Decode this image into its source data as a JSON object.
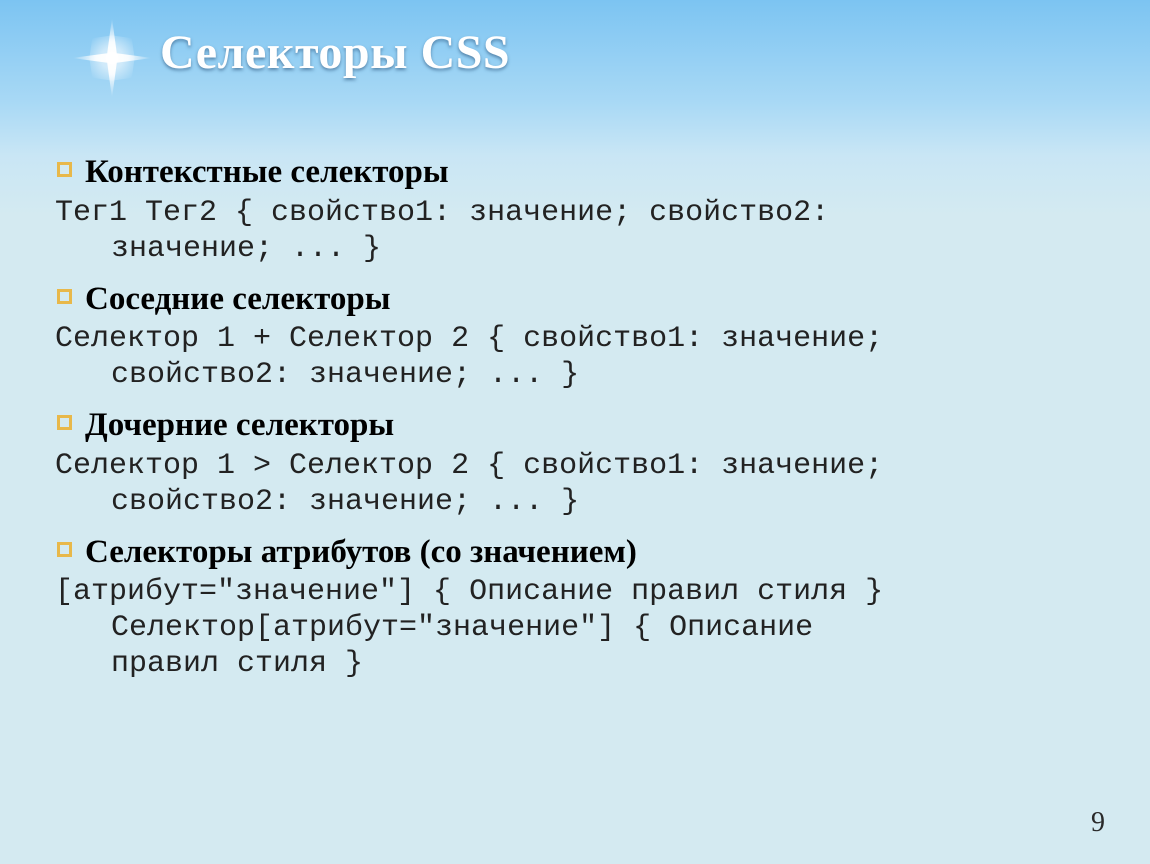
{
  "title": "Селекторы CSS",
  "sections": [
    {
      "heading": "Контекстные селекторы",
      "code_l1": "Тег1 Тег2 { свойство1: значение; свойство2:",
      "code_l2": "значение; ... }",
      "code_l3": ""
    },
    {
      "heading": "Соседние селекторы",
      "code_l1": "Селектор 1 + Селектор 2 { свойство1: значение;",
      "code_l2": "свойство2: значение; ... }",
      "code_l3": ""
    },
    {
      "heading": "Дочерние селекторы",
      "code_l1": "Селектор 1 > Селектор 2 { свойство1: значение;",
      "code_l2": "свойство2: значение; ... }",
      "code_l3": ""
    },
    {
      "heading": "Селекторы атрибутов (со значением)",
      "code_l1": "[атрибут=\"значение\"] { Описание правил стиля }",
      "code_l2": "Селектор[атрибут=\"значение\"] { Описание",
      "code_l3": "правил стиля }"
    }
  ],
  "page_number": "9"
}
